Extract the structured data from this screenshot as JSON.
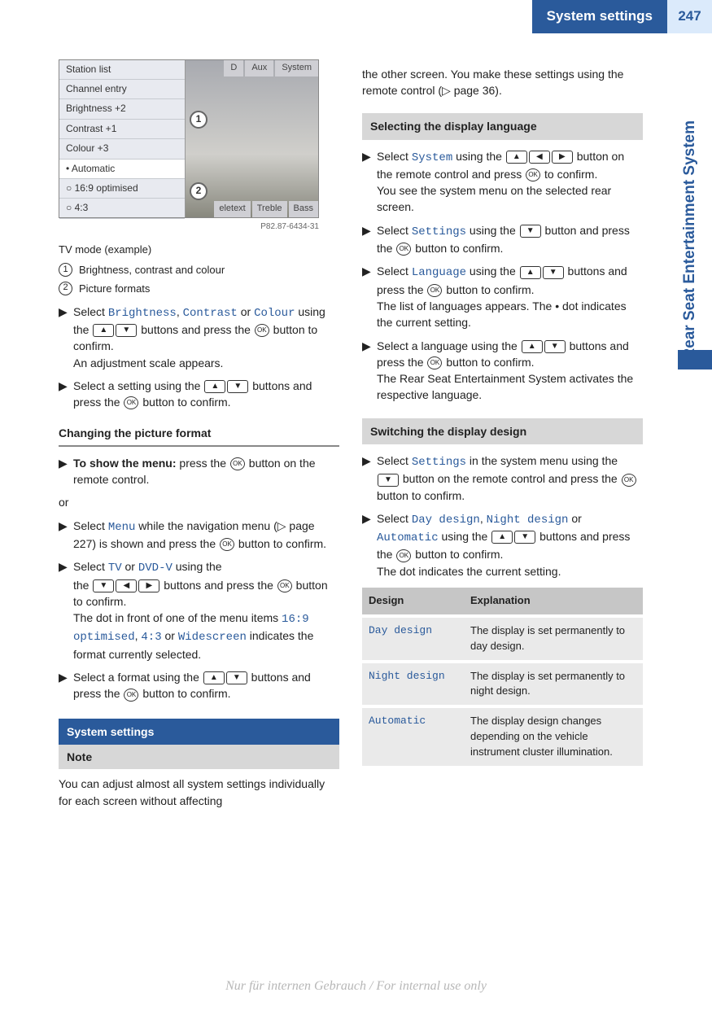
{
  "header": {
    "title": "System settings",
    "page": "247"
  },
  "side_tab": "Rear Seat Entertainment System",
  "screenshot": {
    "left_items": [
      "Station list",
      "Channel entry",
      "Brightness   +2",
      "Contrast      +1",
      "Colour         +3",
      "• Automatic",
      "○ 16:9 optimised",
      "○ 4:3"
    ],
    "top_tabs": [
      "D",
      "Aux",
      "System"
    ],
    "bottom_tabs": [
      "eletext",
      "Treble",
      "Bass"
    ],
    "code": "P82.87-6434-31"
  },
  "caption": "TV mode (example)",
  "legend": [
    {
      "num": "1",
      "text": "Brightness, contrast and colour"
    },
    {
      "num": "2",
      "text": "Picture formats"
    }
  ],
  "left_steps_a": {
    "s1a": "Select ",
    "s1b": "Brightness",
    "s1c": ", ",
    "s1d": "Contrast",
    "s1e": " or ",
    "s1f": "Colour",
    "s1g": " using the ",
    "s1h": " buttons and press the ",
    "s1i": " button to confirm.",
    "s1j": "An adjustment scale appears.",
    "s2a": "Select a setting using the ",
    "s2b": " buttons and press the ",
    "s2c": " button to confirm."
  },
  "sub1": "Changing the picture format",
  "pf": {
    "s1a": "To show the menu:",
    "s1b": " press the ",
    "s1c": " button on the remote control.",
    "or": "or",
    "s2a": "Select ",
    "s2b": "Menu",
    "s2c": " while the navigation menu (▷ page 227) is shown and press the ",
    "s2d": " button to confirm.",
    "s3a": "Select ",
    "s3b": "TV",
    "s3c": " or ",
    "s3d": "DVD-V",
    "s3e": " using the ",
    "s3f": " buttons and press the ",
    "s3g": " button to confirm.",
    "s3h": "The dot in front of one of the menu items ",
    "s3i": "16:9 optimised",
    "s3j": ", ",
    "s3k": "4:3",
    "s3l": " or ",
    "s3m": "Widescreen",
    "s3n": " indicates the format currently selected.",
    "s4a": "Select a format using the ",
    "s4b": " buttons and press the ",
    "s4c": " button to confirm."
  },
  "bar_section": "System settings",
  "bar_note": "Note",
  "note_text_a": "You can adjust almost all system settings individually for each screen without affecting",
  "note_text_b": "the other screen. You make these settings using the remote control (▷ page 36).",
  "grey1": "Selecting the display language",
  "lang": {
    "s1a": "Select ",
    "s1b": "System",
    "s1c": " using the ",
    "s1d": " button on the remote control and press ",
    "s1e": " to confirm.",
    "s1f": "You see the system menu on the selected rear screen.",
    "s2a": "Select ",
    "s2b": "Settings",
    "s2c": " using the ",
    "s2d": " button and press the ",
    "s2e": " button to confirm.",
    "s3a": "Select ",
    "s3b": "Language",
    "s3c": " using the ",
    "s3d": " buttons and press the ",
    "s3e": " button to confirm.",
    "s3f": "The list of languages appears. The  •  dot indicates the current setting.",
    "s4a": "Select a language using the ",
    "s4b": " buttons and press the ",
    "s4c": " button to confirm.",
    "s4d": "The Rear Seat Entertainment System activates the respective language."
  },
  "grey2": "Switching the display design",
  "design": {
    "s1a": "Select ",
    "s1b": "Settings",
    "s1c": " in the system menu using the ",
    "s1d": " button on the remote control and press the ",
    "s1e": " button to confirm.",
    "s2a": "Select ",
    "s2b": "Day design",
    "s2c": ", ",
    "s2d": "Night design",
    "s2e": " or ",
    "s2f": "Automatic",
    "s2g": " using the ",
    "s2h": " buttons and press the ",
    "s2i": " button to confirm.",
    "s2j": "The dot indicates the current setting."
  },
  "table": {
    "h1": "Design",
    "h2": "Explanation",
    "r1a": "Day design",
    "r1b": "The display is set permanently to day design.",
    "r2a": "Night design",
    "r2b": "The display is set permanently to night design.",
    "r3a": "Automatic",
    "r3b": "The display design changes depending on the vehicle instrument cluster illumination."
  },
  "keys": {
    "up": "▲",
    "down": "▼",
    "left": "◀",
    "right": "▶",
    "ok": "OK"
  },
  "footer": "Nur für internen Gebrauch / For internal use only"
}
